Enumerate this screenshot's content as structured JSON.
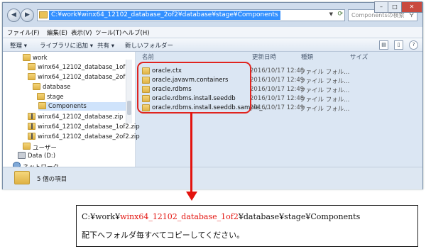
{
  "address_bar": {
    "path": "C:¥work¥winx64_12102_database_2of2¥database¥stage¥Components",
    "search_placeholder": "Componentsの検索"
  },
  "menu": [
    "ファイル(F)",
    "編集(E)",
    "表示(V)",
    "ツール(T)",
    "ヘルプ(H)"
  ],
  "toolbar": {
    "organize": "整理 ▾",
    "add_to_library": "ライブラリに追加 ▾",
    "share": "共有 ▾",
    "new_folder": "新しいフォルダー"
  },
  "nav_tree": [
    {
      "label": "work",
      "kind": "folder"
    },
    {
      "label": "winx64_12102_database_1of2",
      "kind": "folder"
    },
    {
      "label": "winx64_12102_database_2of2",
      "kind": "folder"
    },
    {
      "label": "database",
      "kind": "folder"
    },
    {
      "label": "stage",
      "kind": "folder"
    },
    {
      "label": "Components",
      "kind": "folder",
      "selected": true
    },
    {
      "label": "winx64_12102_database.zip",
      "kind": "zip"
    },
    {
      "label": "winx64_12102_database_1of2.zip",
      "kind": "zip"
    },
    {
      "label": "winx64_12102_database_2of2.zip",
      "kind": "zip"
    },
    {
      "label": "ユーザー",
      "kind": "folder"
    },
    {
      "label": "Data (D:)",
      "kind": "drive"
    },
    {
      "label": "ネットワーク",
      "kind": "network"
    }
  ],
  "columns": {
    "name": "名前",
    "date": "更新日時",
    "type": "種類",
    "size": "サイズ"
  },
  "files": [
    {
      "name": "oracle.ctx",
      "date": "2016/10/17 12:48",
      "type": "ファイル フォル..."
    },
    {
      "name": "oracle.javavm.containers",
      "date": "2016/10/17 12:49",
      "type": "ファイル フォル..."
    },
    {
      "name": "oracle.rdbms",
      "date": "2016/10/17 12:49",
      "type": "ファイル フォル..."
    },
    {
      "name": "oracle.rdbms.install.seeddb",
      "date": "2016/10/17 12:48",
      "type": "ファイル フォル..."
    },
    {
      "name": "oracle.rdbms.install.seeddb.sample_...",
      "date": "2016/10/17 12:49",
      "type": "ファイル フォル..."
    }
  ],
  "status": {
    "count": "5 個の項目"
  },
  "annotation": {
    "line1_prefix": "C:¥work¥",
    "line1_red": "winx64_12102_database_1of2",
    "line1_suffix": "¥database¥stage¥Components",
    "line2": "配下へフォルダ毎すべてコピーしてください。"
  },
  "colors": {
    "highlight": "#e0241f",
    "arrow": "#e3130e",
    "selection": "#3390ff"
  }
}
